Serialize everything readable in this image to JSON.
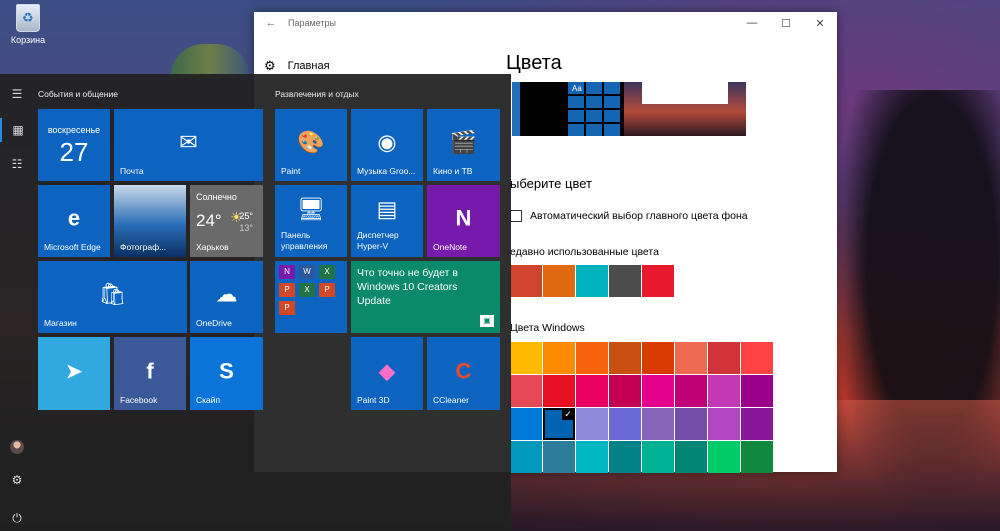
{
  "desktop": {
    "recycle_bin_label": "Корзина"
  },
  "settings": {
    "title": "Параметры",
    "back": "←",
    "minimize": "—",
    "maximize": "☐",
    "close": "✕",
    "home": "Главная",
    "page_title": "Цвета",
    "preview_text": "Aa",
    "choose_color": "ыберите цвет",
    "auto_color": "Автоматический выбор главного цвета фона",
    "recent_heading": "едавно использованные цвета",
    "recent_colors": [
      "#d1452f",
      "#e0690f",
      "#00b2c0",
      "#4c4c4c",
      "#e8192c"
    ],
    "windows_heading": "Цвета Windows",
    "windows_colors": [
      "#ffb900",
      "#ff8c00",
      "#f7630c",
      "#ca5010",
      "#da3b01",
      "#ef6950",
      "#d13438",
      "#ff4343",
      "#e74856",
      "#e81123",
      "#ea005e",
      "#c30052",
      "#e3008c",
      "#bf0077",
      "#c239b3",
      "#9a0089",
      "#0078d7",
      "#0063b1",
      "#8e8cd8",
      "#6b69d6",
      "#8764b8",
      "#744da9",
      "#b146c2",
      "#881798",
      "#0099bc",
      "#2d7d9a",
      "#00b7c3",
      "#038387",
      "#00b294",
      "#018574",
      "#00cc6a",
      "#10893e"
    ],
    "selected_index": 17
  },
  "start": {
    "group1": "События и общение",
    "group2": "Развлечения и отдых",
    "calendar": {
      "dow": "воскресенье",
      "day": "27"
    },
    "weather": {
      "label": "Харьков",
      "title": "Солнечно",
      "temp": "24°",
      "hi": "25°",
      "lo": "13°"
    },
    "news": {
      "headline": "Что точно не будет в Windows 10 Creators Update"
    },
    "tiles": {
      "mail": "Почта",
      "edge": "Microsoft Edge",
      "photos": "Фотограф...",
      "store": "Магазин",
      "onedrive": "OneDrive",
      "facebook": "Facebook",
      "skype": "Скайп",
      "paint": "Paint",
      "groove": "Музыка Groo...",
      "movies": "Кино и ТВ",
      "control_panel": "Панель управления",
      "hyperv": "Диспетчер Hyper-V",
      "onenote": "OneNote",
      "paint3d": "Paint 3D",
      "ccleaner": "CCleaner"
    },
    "office_letters": [
      "N",
      "W",
      "X",
      "P",
      "X",
      "P",
      "P"
    ]
  }
}
